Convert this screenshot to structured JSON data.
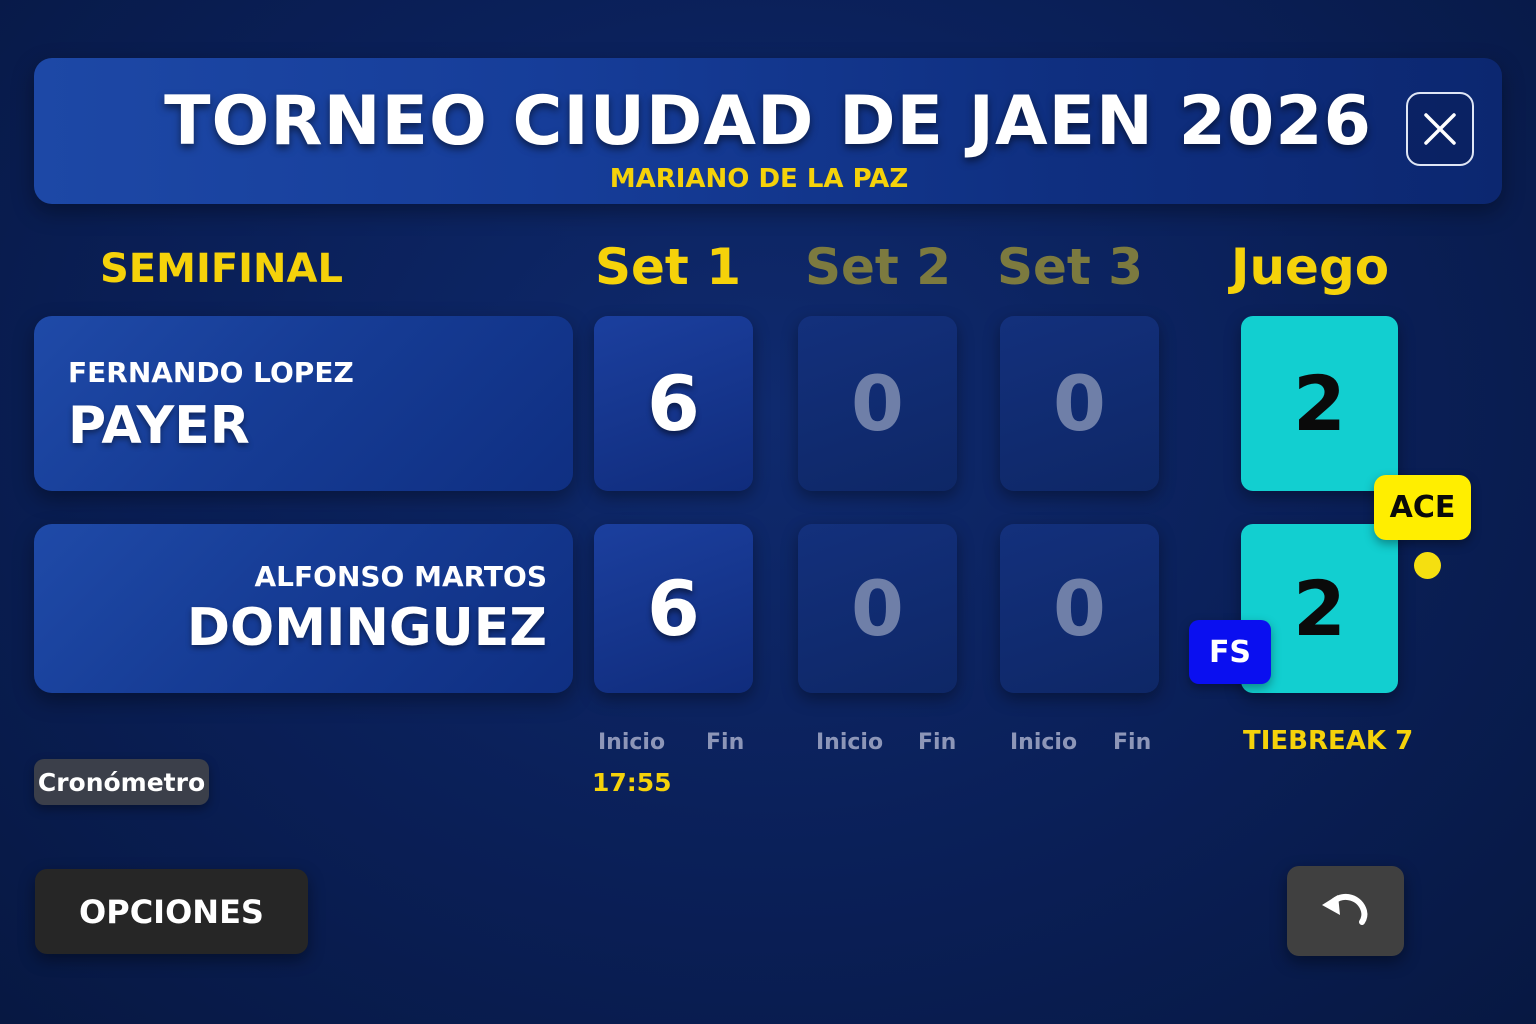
{
  "header": {
    "title": "TORNEO CIUDAD DE JAEN 2026",
    "subtitle": "MARIANO DE LA PAZ",
    "close_icon": "close-icon"
  },
  "match": {
    "round": "SEMIFINAL",
    "columns": {
      "set1": "Set 1",
      "set2": "Set 2",
      "set3": "Set 3",
      "game": "Juego"
    }
  },
  "players": [
    {
      "first_name": "FERNANDO LOPEZ",
      "last_name": "PAYER",
      "sets": [
        "6",
        "0",
        "0"
      ],
      "game": "2"
    },
    {
      "first_name": "ALFONSO MARTOS",
      "last_name": "DOMINGUEZ",
      "sets": [
        "6",
        "0",
        "0"
      ],
      "game": "2"
    }
  ],
  "badges": {
    "ace": "ACE",
    "fs": "FS"
  },
  "times": {
    "start_label": "Inicio",
    "end_label": "Fin",
    "set1_start": "17:55"
  },
  "tiebreak": "TIEBREAK 7",
  "buttons": {
    "crono": "Cronómetro",
    "options": "OPCIONES",
    "undo_icon": "undo-icon"
  },
  "colors": {
    "accent_yellow": "#f5d20a",
    "game_cyan": "#12cfd0",
    "fs_blue": "#0a0ff0",
    "ace_yellow": "#ffee00"
  }
}
